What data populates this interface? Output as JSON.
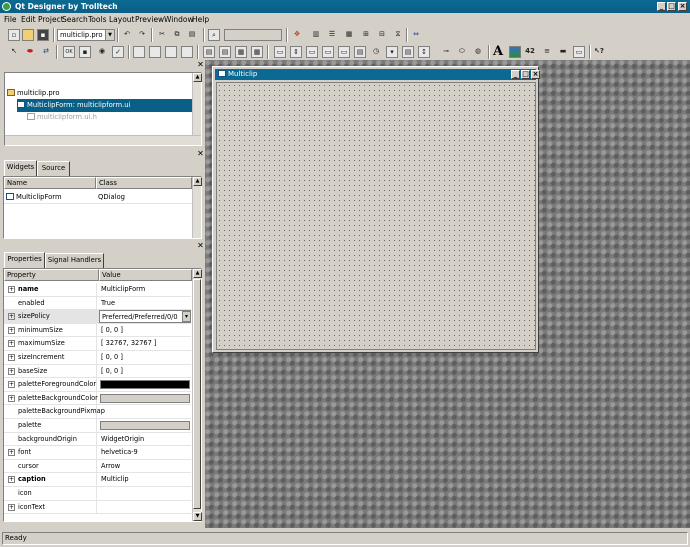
{
  "window": {
    "title": "Qt Designer by Trolltech"
  },
  "menu": [
    "File",
    "Edit",
    "Project",
    "Search",
    "Tools",
    "Layout",
    "Preview",
    "Window",
    "Help"
  ],
  "project_combo": {
    "value": "multiclip.pro"
  },
  "toolbar_font_glyph": "A",
  "project_overview": {
    "items": [
      {
        "label": "multiclip.pro"
      },
      {
        "label": "MulticlipForm: multiclipform.ui"
      },
      {
        "label": "multiclipform.ui.h"
      }
    ]
  },
  "object_explorer": {
    "tabs": [
      "Widgets",
      "Source"
    ],
    "headers": [
      "Name",
      "Class"
    ],
    "rows": [
      {
        "name": "MulticlipForm",
        "class": "QDialog"
      }
    ]
  },
  "property_editor": {
    "tabs": [
      "Properties",
      "Signal Handlers"
    ],
    "headers": [
      "Property",
      "Value"
    ],
    "rows": [
      {
        "name": "name",
        "value": "MulticlipForm",
        "expandable": true,
        "bold": true
      },
      {
        "name": "enabled",
        "value": "True",
        "expandable": false
      },
      {
        "name": "sizePolicy",
        "value": "Preferred/Preferred/0/0",
        "expandable": true,
        "selected": true
      },
      {
        "name": "minimumSize",
        "value": "[ 0, 0 ]",
        "expandable": true
      },
      {
        "name": "maximumSize",
        "value": "[ 32767, 32767 ]",
        "expandable": true
      },
      {
        "name": "sizeIncrement",
        "value": "[ 0, 0 ]",
        "expandable": true
      },
      {
        "name": "baseSize",
        "value": "[ 0, 0 ]",
        "expandable": true
      },
      {
        "name": "paletteForegroundColor",
        "value": "",
        "expandable": true,
        "color": "#000000"
      },
      {
        "name": "paletteBackgroundColor",
        "value": "",
        "expandable": true,
        "color": "#d4d0c8"
      },
      {
        "name": "paletteBackgroundPixmap",
        "value": "",
        "expandable": false
      },
      {
        "name": "palette",
        "value": "",
        "expandable": false,
        "color": "#d4d0c8"
      },
      {
        "name": "backgroundOrigin",
        "value": "WidgetOrigin",
        "expandable": false
      },
      {
        "name": "font",
        "value": "helvetica-9",
        "expandable": true
      },
      {
        "name": "cursor",
        "value": "Arrow",
        "expandable": false
      },
      {
        "name": "caption",
        "value": "Multiclip",
        "expandable": true,
        "bold": true
      },
      {
        "name": "icon",
        "value": "",
        "expandable": false
      },
      {
        "name": "iconText",
        "value": "",
        "expandable": true
      }
    ]
  },
  "form_window": {
    "title": "Multiclip"
  },
  "statusbar": {
    "text": "Ready"
  },
  "colors": {
    "titlebar": "#0b6a93",
    "selection": "#0a5f86",
    "face": "#d4d0c8"
  }
}
